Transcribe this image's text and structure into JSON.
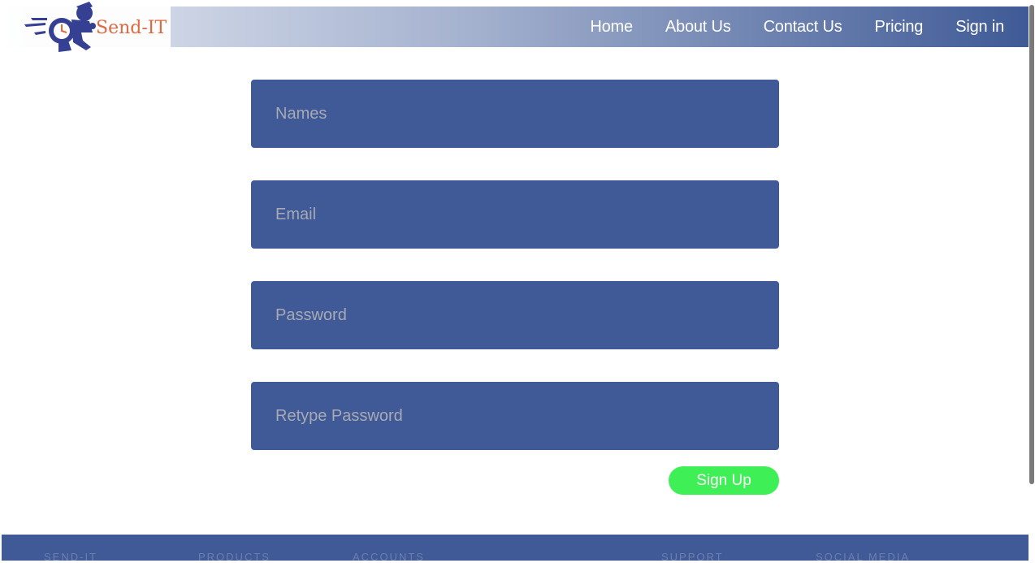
{
  "brand": {
    "name": "Send-IT",
    "logo_icon": "running-courier-clock-icon"
  },
  "nav": {
    "items": [
      "Home",
      "About Us",
      "Contact Us",
      "Pricing",
      "Sign in"
    ]
  },
  "form": {
    "names_placeholder": "Names",
    "email_placeholder": "Email",
    "password_placeholder": "Password",
    "retype_placeholder": "Retype Password",
    "submit_label": "Sign Up"
  },
  "footer": {
    "columns": [
      "SEND-IT",
      "PRODUCTS",
      "ACCOUNTS",
      "SUPPORT",
      "SOCIAL MEDIA"
    ]
  },
  "colors": {
    "primary": "#3f5a96",
    "accent_button": "#3ef055",
    "logo_text": "#e0653a",
    "placeholder": "#a7a9b4"
  }
}
